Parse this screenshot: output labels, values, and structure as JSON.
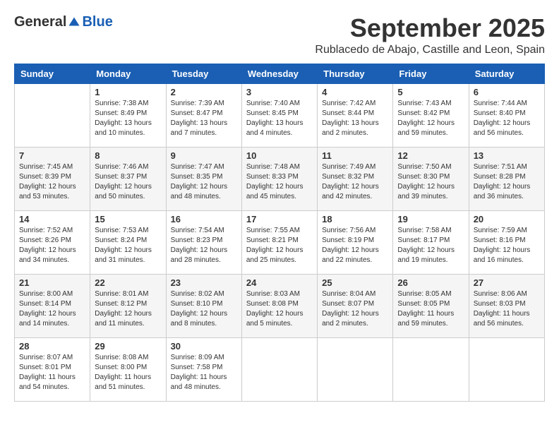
{
  "logo": {
    "general": "General",
    "blue": "Blue"
  },
  "title": "September 2025",
  "location": "Rublacedo de Abajo, Castille and Leon, Spain",
  "days_of_week": [
    "Sunday",
    "Monday",
    "Tuesday",
    "Wednesday",
    "Thursday",
    "Friday",
    "Saturday"
  ],
  "weeks": [
    [
      {
        "day": "",
        "info": ""
      },
      {
        "day": "1",
        "info": "Sunrise: 7:38 AM\nSunset: 8:49 PM\nDaylight: 13 hours\nand 10 minutes."
      },
      {
        "day": "2",
        "info": "Sunrise: 7:39 AM\nSunset: 8:47 PM\nDaylight: 13 hours\nand 7 minutes."
      },
      {
        "day": "3",
        "info": "Sunrise: 7:40 AM\nSunset: 8:45 PM\nDaylight: 13 hours\nand 4 minutes."
      },
      {
        "day": "4",
        "info": "Sunrise: 7:42 AM\nSunset: 8:44 PM\nDaylight: 13 hours\nand 2 minutes."
      },
      {
        "day": "5",
        "info": "Sunrise: 7:43 AM\nSunset: 8:42 PM\nDaylight: 12 hours\nand 59 minutes."
      },
      {
        "day": "6",
        "info": "Sunrise: 7:44 AM\nSunset: 8:40 PM\nDaylight: 12 hours\nand 56 minutes."
      }
    ],
    [
      {
        "day": "7",
        "info": "Sunrise: 7:45 AM\nSunset: 8:39 PM\nDaylight: 12 hours\nand 53 minutes."
      },
      {
        "day": "8",
        "info": "Sunrise: 7:46 AM\nSunset: 8:37 PM\nDaylight: 12 hours\nand 50 minutes."
      },
      {
        "day": "9",
        "info": "Sunrise: 7:47 AM\nSunset: 8:35 PM\nDaylight: 12 hours\nand 48 minutes."
      },
      {
        "day": "10",
        "info": "Sunrise: 7:48 AM\nSunset: 8:33 PM\nDaylight: 12 hours\nand 45 minutes."
      },
      {
        "day": "11",
        "info": "Sunrise: 7:49 AM\nSunset: 8:32 PM\nDaylight: 12 hours\nand 42 minutes."
      },
      {
        "day": "12",
        "info": "Sunrise: 7:50 AM\nSunset: 8:30 PM\nDaylight: 12 hours\nand 39 minutes."
      },
      {
        "day": "13",
        "info": "Sunrise: 7:51 AM\nSunset: 8:28 PM\nDaylight: 12 hours\nand 36 minutes."
      }
    ],
    [
      {
        "day": "14",
        "info": "Sunrise: 7:52 AM\nSunset: 8:26 PM\nDaylight: 12 hours\nand 34 minutes."
      },
      {
        "day": "15",
        "info": "Sunrise: 7:53 AM\nSunset: 8:24 PM\nDaylight: 12 hours\nand 31 minutes."
      },
      {
        "day": "16",
        "info": "Sunrise: 7:54 AM\nSunset: 8:23 PM\nDaylight: 12 hours\nand 28 minutes."
      },
      {
        "day": "17",
        "info": "Sunrise: 7:55 AM\nSunset: 8:21 PM\nDaylight: 12 hours\nand 25 minutes."
      },
      {
        "day": "18",
        "info": "Sunrise: 7:56 AM\nSunset: 8:19 PM\nDaylight: 12 hours\nand 22 minutes."
      },
      {
        "day": "19",
        "info": "Sunrise: 7:58 AM\nSunset: 8:17 PM\nDaylight: 12 hours\nand 19 minutes."
      },
      {
        "day": "20",
        "info": "Sunrise: 7:59 AM\nSunset: 8:16 PM\nDaylight: 12 hours\nand 16 minutes."
      }
    ],
    [
      {
        "day": "21",
        "info": "Sunrise: 8:00 AM\nSunset: 8:14 PM\nDaylight: 12 hours\nand 14 minutes."
      },
      {
        "day": "22",
        "info": "Sunrise: 8:01 AM\nSunset: 8:12 PM\nDaylight: 12 hours\nand 11 minutes."
      },
      {
        "day": "23",
        "info": "Sunrise: 8:02 AM\nSunset: 8:10 PM\nDaylight: 12 hours\nand 8 minutes."
      },
      {
        "day": "24",
        "info": "Sunrise: 8:03 AM\nSunset: 8:08 PM\nDaylight: 12 hours\nand 5 minutes."
      },
      {
        "day": "25",
        "info": "Sunrise: 8:04 AM\nSunset: 8:07 PM\nDaylight: 12 hours\nand 2 minutes."
      },
      {
        "day": "26",
        "info": "Sunrise: 8:05 AM\nSunset: 8:05 PM\nDaylight: 11 hours\nand 59 minutes."
      },
      {
        "day": "27",
        "info": "Sunrise: 8:06 AM\nSunset: 8:03 PM\nDaylight: 11 hours\nand 56 minutes."
      }
    ],
    [
      {
        "day": "28",
        "info": "Sunrise: 8:07 AM\nSunset: 8:01 PM\nDaylight: 11 hours\nand 54 minutes."
      },
      {
        "day": "29",
        "info": "Sunrise: 8:08 AM\nSunset: 8:00 PM\nDaylight: 11 hours\nand 51 minutes."
      },
      {
        "day": "30",
        "info": "Sunrise: 8:09 AM\nSunset: 7:58 PM\nDaylight: 11 hours\nand 48 minutes."
      },
      {
        "day": "",
        "info": ""
      },
      {
        "day": "",
        "info": ""
      },
      {
        "day": "",
        "info": ""
      },
      {
        "day": "",
        "info": ""
      }
    ]
  ]
}
